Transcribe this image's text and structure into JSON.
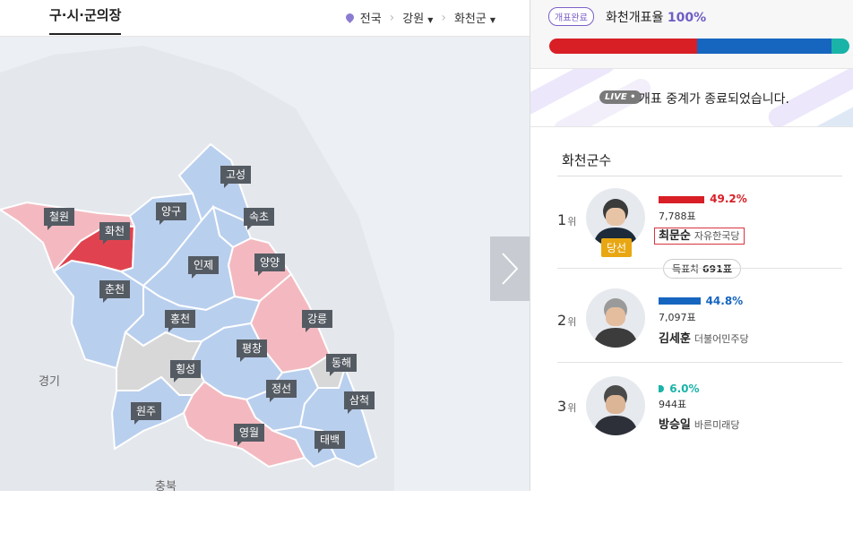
{
  "header": {
    "tab_label": "구·시·군의장",
    "breadcrumb": {
      "level1": "전국",
      "level2": "강원",
      "level3": "화천군"
    }
  },
  "map": {
    "province_labels": [
      "경기",
      "충북"
    ],
    "regions": [
      {
        "id": "cheorwon",
        "label": "철원",
        "party": "red-light"
      },
      {
        "id": "hwacheon",
        "label": "화천",
        "party": "red-dark"
      },
      {
        "id": "yanggu",
        "label": "양구",
        "party": "blue"
      },
      {
        "id": "goseong",
        "label": "고성",
        "party": "blue"
      },
      {
        "id": "sokcho",
        "label": "속초",
        "party": "blue"
      },
      {
        "id": "inje",
        "label": "인제",
        "party": "blue"
      },
      {
        "id": "yangyang",
        "label": "양양",
        "party": "red-light"
      },
      {
        "id": "chuncheon",
        "label": "춘천",
        "party": "blue"
      },
      {
        "id": "hongcheon",
        "label": "홍천",
        "party": "blue"
      },
      {
        "id": "gangneung",
        "label": "강릉",
        "party": "red-light"
      },
      {
        "id": "pyeongchang",
        "label": "평창",
        "party": "blue"
      },
      {
        "id": "donghae",
        "label": "동해",
        "party": "gray"
      },
      {
        "id": "hoengseong",
        "label": "횡성",
        "party": "gray"
      },
      {
        "id": "jeongseon",
        "label": "정선",
        "party": "blue"
      },
      {
        "id": "samcheok",
        "label": "삼척",
        "party": "blue"
      },
      {
        "id": "wonju",
        "label": "원주",
        "party": "blue"
      },
      {
        "id": "yeongwol",
        "label": "영월",
        "party": "red-light"
      },
      {
        "id": "taebaek",
        "label": "태백",
        "party": "blue"
      }
    ],
    "colors": {
      "blue": "#b9cfee",
      "red-light": "#f4b9c0",
      "red-dark": "#e0434f",
      "gray": "#d8d8d8",
      "border": "#ffffff"
    }
  },
  "count": {
    "badge": "개표완료",
    "title": "화천개표율",
    "percent": "100%",
    "progress_shares": [
      49.2,
      44.8,
      6.0
    ],
    "progress_colors": [
      "#d81f26",
      "#1666c0",
      "#19b3a8"
    ]
  },
  "live": {
    "badge": "LIVE",
    "message": "개표 중계가 종료되었습니다."
  },
  "race": {
    "title": "화천군수",
    "margin_label": "득표차",
    "margin_value": "691표",
    "candidates": [
      {
        "rank": "1",
        "rank_suffix": "위",
        "pct": "49.2%",
        "share": 49.2,
        "votes": "7,788표",
        "name": "최문순",
        "party": "자유한국당",
        "color": "#d81f26",
        "elected": "당선"
      },
      {
        "rank": "2",
        "rank_suffix": "위",
        "pct": "44.8%",
        "share": 44.8,
        "votes": "7,097표",
        "name": "김세훈",
        "party": "더불어민주당",
        "color": "#1666c0"
      },
      {
        "rank": "3",
        "rank_suffix": "위",
        "pct": "6.0%",
        "share": 6.0,
        "votes": "944표",
        "name": "방승일",
        "party": "바른미래당",
        "color": "#19b3a8"
      }
    ]
  }
}
